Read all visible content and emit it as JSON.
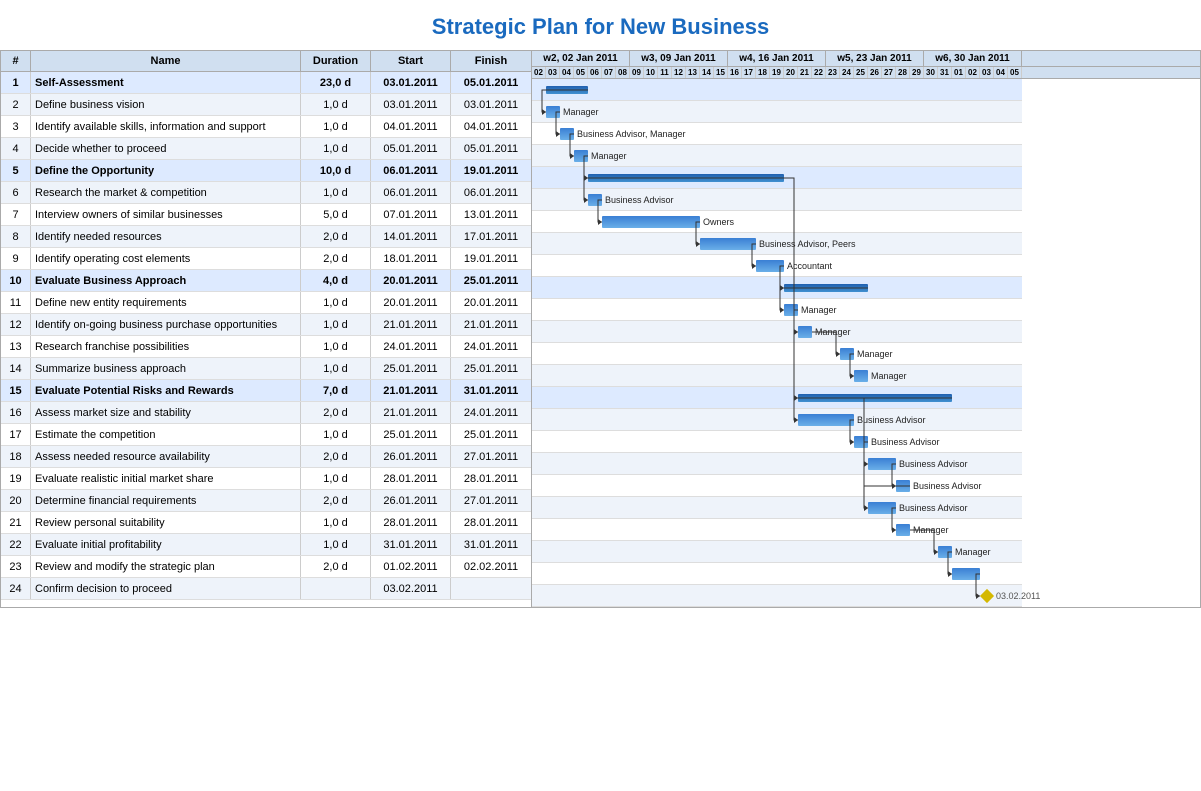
{
  "title": "Strategic Plan for New Business",
  "table": {
    "headers": [
      "#",
      "Name",
      "Duration",
      "Start",
      "Finish"
    ],
    "rows": [
      {
        "id": 1,
        "name": "Self-Assessment",
        "duration": "23,0 d",
        "start": "03.01.2011",
        "finish": "05.01.2011",
        "type": "summary"
      },
      {
        "id": 2,
        "name": "Define business vision",
        "duration": "1,0 d",
        "start": "03.01.2011",
        "finish": "03.01.2011",
        "type": "task",
        "resource": "Manager"
      },
      {
        "id": 3,
        "name": "Identify available skills, information and support",
        "duration": "1,0 d",
        "start": "04.01.2011",
        "finish": "04.01.2011",
        "type": "task",
        "resource": "Business Advisor, Manager"
      },
      {
        "id": 4,
        "name": "Decide whether to proceed",
        "duration": "1,0 d",
        "start": "05.01.2011",
        "finish": "05.01.2011",
        "type": "task",
        "resource": "Manager"
      },
      {
        "id": 5,
        "name": "Define the Opportunity",
        "duration": "10,0 d",
        "start": "06.01.2011",
        "finish": "19.01.2011",
        "type": "summary"
      },
      {
        "id": 6,
        "name": "Research the market & competition",
        "duration": "1,0 d",
        "start": "06.01.2011",
        "finish": "06.01.2011",
        "type": "task",
        "resource": "Business Advisor"
      },
      {
        "id": 7,
        "name": "Interview owners of similar businesses",
        "duration": "5,0 d",
        "start": "07.01.2011",
        "finish": "13.01.2011",
        "type": "task",
        "resource": "Owners"
      },
      {
        "id": 8,
        "name": "Identify needed resources",
        "duration": "2,0 d",
        "start": "14.01.2011",
        "finish": "17.01.2011",
        "type": "task",
        "resource": "Business Advisor, Peers"
      },
      {
        "id": 9,
        "name": "Identify operating cost elements",
        "duration": "2,0 d",
        "start": "18.01.2011",
        "finish": "19.01.2011",
        "type": "task",
        "resource": "Accountant"
      },
      {
        "id": 10,
        "name": "Evaluate Business Approach",
        "duration": "4,0 d",
        "start": "20.01.2011",
        "finish": "25.01.2011",
        "type": "summary"
      },
      {
        "id": 11,
        "name": "Define new entity requirements",
        "duration": "1,0 d",
        "start": "20.01.2011",
        "finish": "20.01.2011",
        "type": "task",
        "resource": "Manager"
      },
      {
        "id": 12,
        "name": "Identify on-going business purchase opportunities",
        "duration": "1,0 d",
        "start": "21.01.2011",
        "finish": "21.01.2011",
        "type": "task",
        "resource": "Manager"
      },
      {
        "id": 13,
        "name": "Research franchise possibilities",
        "duration": "1,0 d",
        "start": "24.01.2011",
        "finish": "24.01.2011",
        "type": "task",
        "resource": "Manager"
      },
      {
        "id": 14,
        "name": "Summarize business approach",
        "duration": "1,0 d",
        "start": "25.01.2011",
        "finish": "25.01.2011",
        "type": "task",
        "resource": "Manager"
      },
      {
        "id": 15,
        "name": "Evaluate Potential Risks and Rewards",
        "duration": "7,0 d",
        "start": "21.01.2011",
        "finish": "31.01.2011",
        "type": "summary"
      },
      {
        "id": 16,
        "name": "Assess market size and stability",
        "duration": "2,0 d",
        "start": "21.01.2011",
        "finish": "24.01.2011",
        "type": "task",
        "resource": "Business Advisor"
      },
      {
        "id": 17,
        "name": "Estimate the competition",
        "duration": "1,0 d",
        "start": "25.01.2011",
        "finish": "25.01.2011",
        "type": "task",
        "resource": "Business Advisor"
      },
      {
        "id": 18,
        "name": "Assess needed resource availability",
        "duration": "2,0 d",
        "start": "26.01.2011",
        "finish": "27.01.2011",
        "type": "task",
        "resource": "Business Advisor"
      },
      {
        "id": 19,
        "name": "Evaluate realistic initial market share",
        "duration": "1,0 d",
        "start": "28.01.2011",
        "finish": "28.01.2011",
        "type": "task",
        "resource": "Business Advisor"
      },
      {
        "id": 20,
        "name": "Determine financial requirements",
        "duration": "2,0 d",
        "start": "26.01.2011",
        "finish": "27.01.2011",
        "type": "task",
        "resource": "Business Advisor"
      },
      {
        "id": 21,
        "name": "Review personal suitability",
        "duration": "1,0 d",
        "start": "28.01.2011",
        "finish": "28.01.2011",
        "type": "task",
        "resource": "Manager"
      },
      {
        "id": 22,
        "name": "Evaluate initial profitability",
        "duration": "1,0 d",
        "start": "31.01.2011",
        "finish": "31.01.2011",
        "type": "task",
        "resource": "Manager"
      },
      {
        "id": 23,
        "name": "Review and modify the strategic plan",
        "duration": "2,0 d",
        "start": "01.02.2011",
        "finish": "02.02.2011",
        "type": "task"
      },
      {
        "id": 24,
        "name": "Confirm decision to proceed",
        "duration": "",
        "start": "03.02.2011",
        "finish": "",
        "type": "milestone"
      }
    ]
  },
  "weeks": [
    {
      "label": "w2, 02 Jan 2011",
      "days": [
        "02",
        "03",
        "04",
        "05",
        "06",
        "07",
        "08"
      ]
    },
    {
      "label": "w3, 09 Jan 2011",
      "days": [
        "09",
        "10",
        "11",
        "12",
        "13",
        "14",
        "15"
      ]
    },
    {
      "label": "w4, 16 Jan 2011",
      "days": [
        "16",
        "17",
        "18",
        "19",
        "20",
        "21",
        "22"
      ]
    },
    {
      "label": "w5, 23 Jan 2011",
      "days": [
        "23",
        "24",
        "25",
        "26",
        "27",
        "28",
        "29"
      ]
    },
    {
      "label": "w6, 30 Jan 2011",
      "days": [
        "30",
        "31",
        "01",
        "02",
        "03",
        "04",
        "05"
      ]
    }
  ]
}
